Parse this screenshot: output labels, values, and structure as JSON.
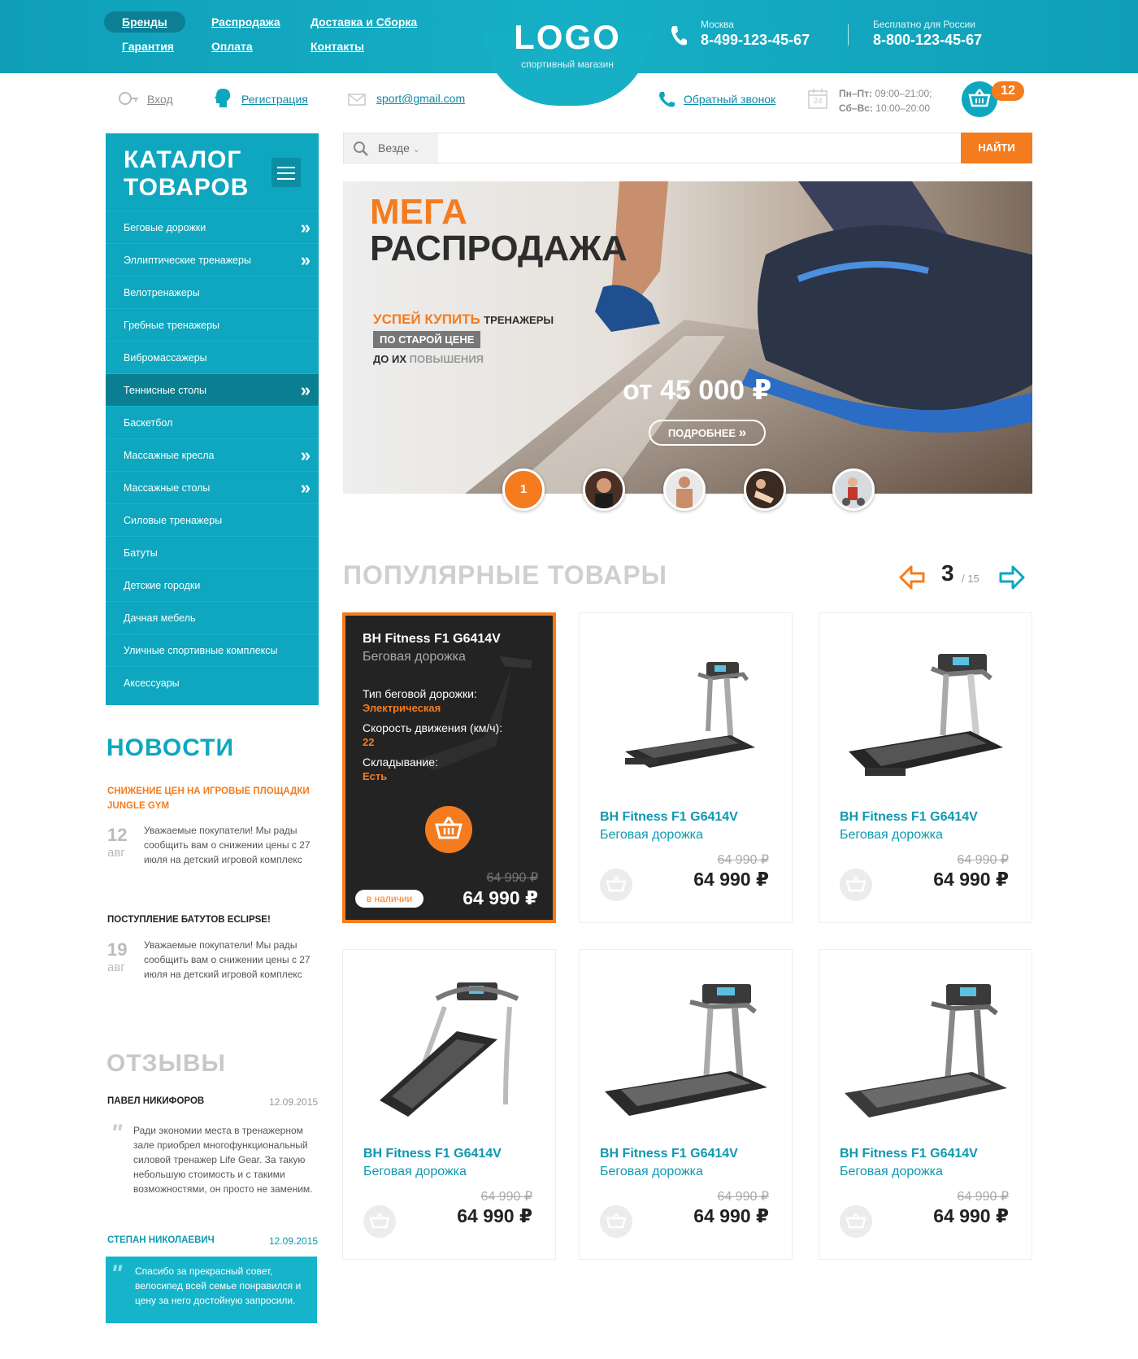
{
  "nav": {
    "items": [
      "Бренды",
      "Распродажа",
      "Доставка и Сборка",
      "Гарантия",
      "Оплата",
      "Контакты"
    ]
  },
  "logo": {
    "text": "LOGO",
    "subtitle": "спортивный магазин"
  },
  "phones": [
    {
      "label": "Москва",
      "number": "8-499-123-45-67"
    },
    {
      "label": "Бесплатно для России",
      "number": "8-800-123-45-67"
    }
  ],
  "subheader": {
    "login": "Вход",
    "register": "Регистрация",
    "email": "sport@gmail.com",
    "callback": "Обратный звонок",
    "hours_weekday_label": "Пн–Пт:",
    "hours_weekday": "09:00–21:00;",
    "hours_weekend_label": "Сб–Вс:",
    "hours_weekend": "10:00–20:00",
    "calendar_day": "24",
    "cart_count": "12"
  },
  "search": {
    "scope": "Везде",
    "button": "НАЙТИ"
  },
  "catalog": {
    "title_line1": "КАТАЛОГ",
    "title_line2": "ТОВАРОВ",
    "items": [
      {
        "label": "Беговые дорожки"
      },
      {
        "label": "Эллиптические тренажеры"
      },
      {
        "label": "Велотренажеры"
      },
      {
        "label": "Гребные тренажеры"
      },
      {
        "label": "Вибромассажеры"
      },
      {
        "label": "Теннисные столы"
      },
      {
        "label": "Баскетбол"
      },
      {
        "label": "Массажные кресла"
      },
      {
        "label": "Массажные столы"
      },
      {
        "label": "Силовые тренажеры"
      },
      {
        "label": "Батуты"
      },
      {
        "label": "Детские городки"
      },
      {
        "label": "Дачная мебель"
      },
      {
        "label": "Уличные спортивные комплексы"
      },
      {
        "label": "Аксессуары"
      }
    ]
  },
  "banner": {
    "title1": "МЕГА",
    "title2": "РАСПРОДАЖА",
    "line1_accent": "УСПЕЙ КУПИТЬ",
    "line1_rest": "ТРЕНАЖЕРЫ",
    "line2": "ПО СТАРОЙ ЦЕНЕ",
    "line3_a": "ДО ИХ",
    "line3_b": "ПОВЫШЕНИЯ",
    "price": "от 45 000 ₽",
    "more": "ПОДРОБНЕЕ",
    "active_slide": "1"
  },
  "news": {
    "title": "НОВОСТИ",
    "items": [
      {
        "title": "СНИЖЕНИЕ ЦЕН НА ИГРОВЫЕ ПЛОЩАДКИ JUNGLE GYM",
        "day": "12",
        "month": "авг",
        "text": "Уважаемые покупатели! Мы рады сообщить вам о снижении цены с 27 июля на детский игровой комплекс"
      },
      {
        "title": "ПОСТУПЛЕНИЕ БАТУТОВ ECLIPSE!",
        "day": "19",
        "month": "авг",
        "text": "Уважаемые покупатели! Мы рады сообщить вам о снижении цены с 27 июля на детский игровой комплекс"
      }
    ]
  },
  "reviews": {
    "title": "ОТЗЫВЫ",
    "items": [
      {
        "author": "ПАВЕЛ НИКИФОРОВ",
        "date": "12.09.2015",
        "text": "Ради экономии места в тренажерном зале приобрел многофункциональный силовой тренажер Life Gear. За такую небольшую стоимость и с такими возможностями, он просто не заменим."
      },
      {
        "author": "СТЕПАН НИКОЛАЕВИЧ",
        "date": "12.09.2015",
        "text": "Спасибо за прекрасный совет, велосипед всей семье понравился и цену за него достойную запросили."
      }
    ]
  },
  "popular": {
    "title": "ПОПУЛЯРНЫЕ ТОВАРЫ",
    "page": "3",
    "total": "/ 15",
    "featured": {
      "name": "BH Fitness F1 G6414V",
      "type": "Беговая дорожка",
      "specs": [
        {
          "label": "Тип беговой дорожки:",
          "value": "Электрическая"
        },
        {
          "label": "Скорость движения (км/ч):",
          "value": "22"
        },
        {
          "label": "Складывание:",
          "value": "Есть"
        }
      ],
      "stock": "в наличии",
      "old_price": "64 990 ₽",
      "price": "64 990 ₽"
    },
    "products": [
      {
        "name": "BH Fitness F1 G6414V",
        "type": "Беговая дорожка",
        "old_price": "64 990 ₽",
        "price": "64 990 ₽"
      },
      {
        "name": "BH Fitness F1 G6414V",
        "type": "Беговая дорожка",
        "old_price": "64 990 ₽",
        "price": "64 990 ₽"
      },
      {
        "name": "BH Fitness F1 G6414V",
        "type": "Беговая дорожка",
        "old_price": "64 990 ₽",
        "price": "64 990 ₽"
      },
      {
        "name": "BH Fitness F1 G6414V",
        "type": "Беговая дорожка",
        "old_price": "64 990 ₽",
        "price": "64 990 ₽"
      },
      {
        "name": "BH Fitness F1 G6414V",
        "type": "Беговая дорожка",
        "old_price": "64 990 ₽",
        "price": "64 990 ₽"
      }
    ]
  },
  "colors": {
    "teal": "#0ea7bf",
    "orange": "#f47c1f",
    "dark": "#222222"
  }
}
